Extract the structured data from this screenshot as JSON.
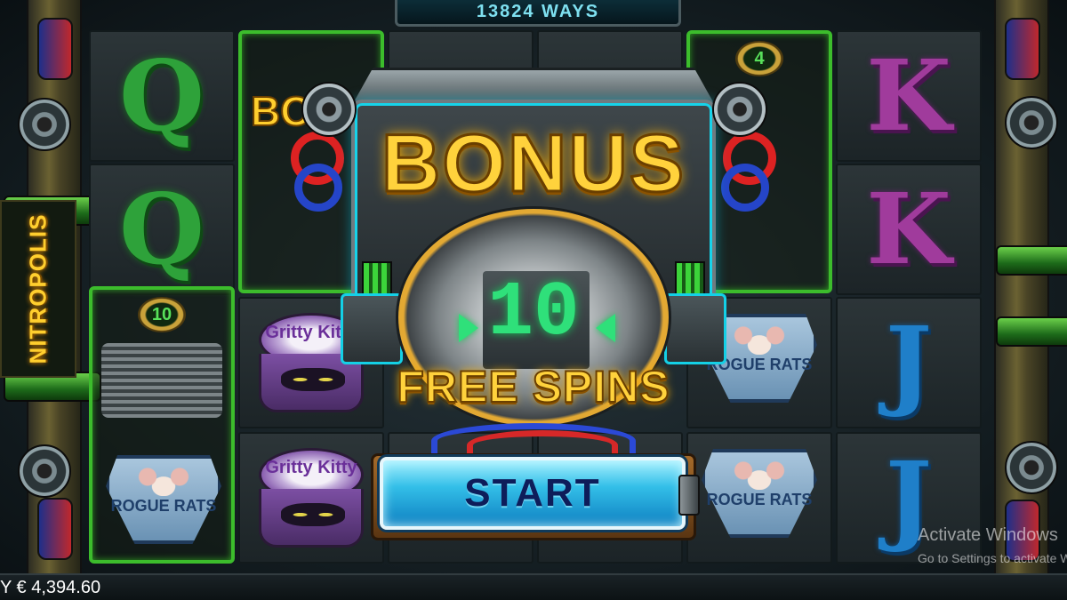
{
  "game": {
    "brand": "NITROPOLIS",
    "ways_label": "13824 WAYS"
  },
  "reels": {
    "col1": [
      "Q",
      "Q"
    ],
    "col2_can_label": "Gritty Kitty",
    "col2b_can_label": "Gritty Kitty",
    "rat_label": "ROGUE RATS",
    "col6": [
      "K",
      "K",
      "J",
      "J"
    ],
    "bonus_frame_counts": [
      "4",
      "10"
    ],
    "bonus_partial": "BON"
  },
  "modal": {
    "title": "BONUS",
    "spins_count": "10",
    "spins_label": "FREE SPINS",
    "start_label": "START"
  },
  "footer": {
    "balance": "Y € 4,394.60"
  },
  "watermark": {
    "line1": "Activate Windows",
    "line2": "Go to Settings to activate Windows."
  },
  "colors": {
    "gold": "#ffd23c",
    "neon_green": "#2fe07a",
    "cyan": "#16d3ea",
    "start_blue": "#33bfe8"
  }
}
